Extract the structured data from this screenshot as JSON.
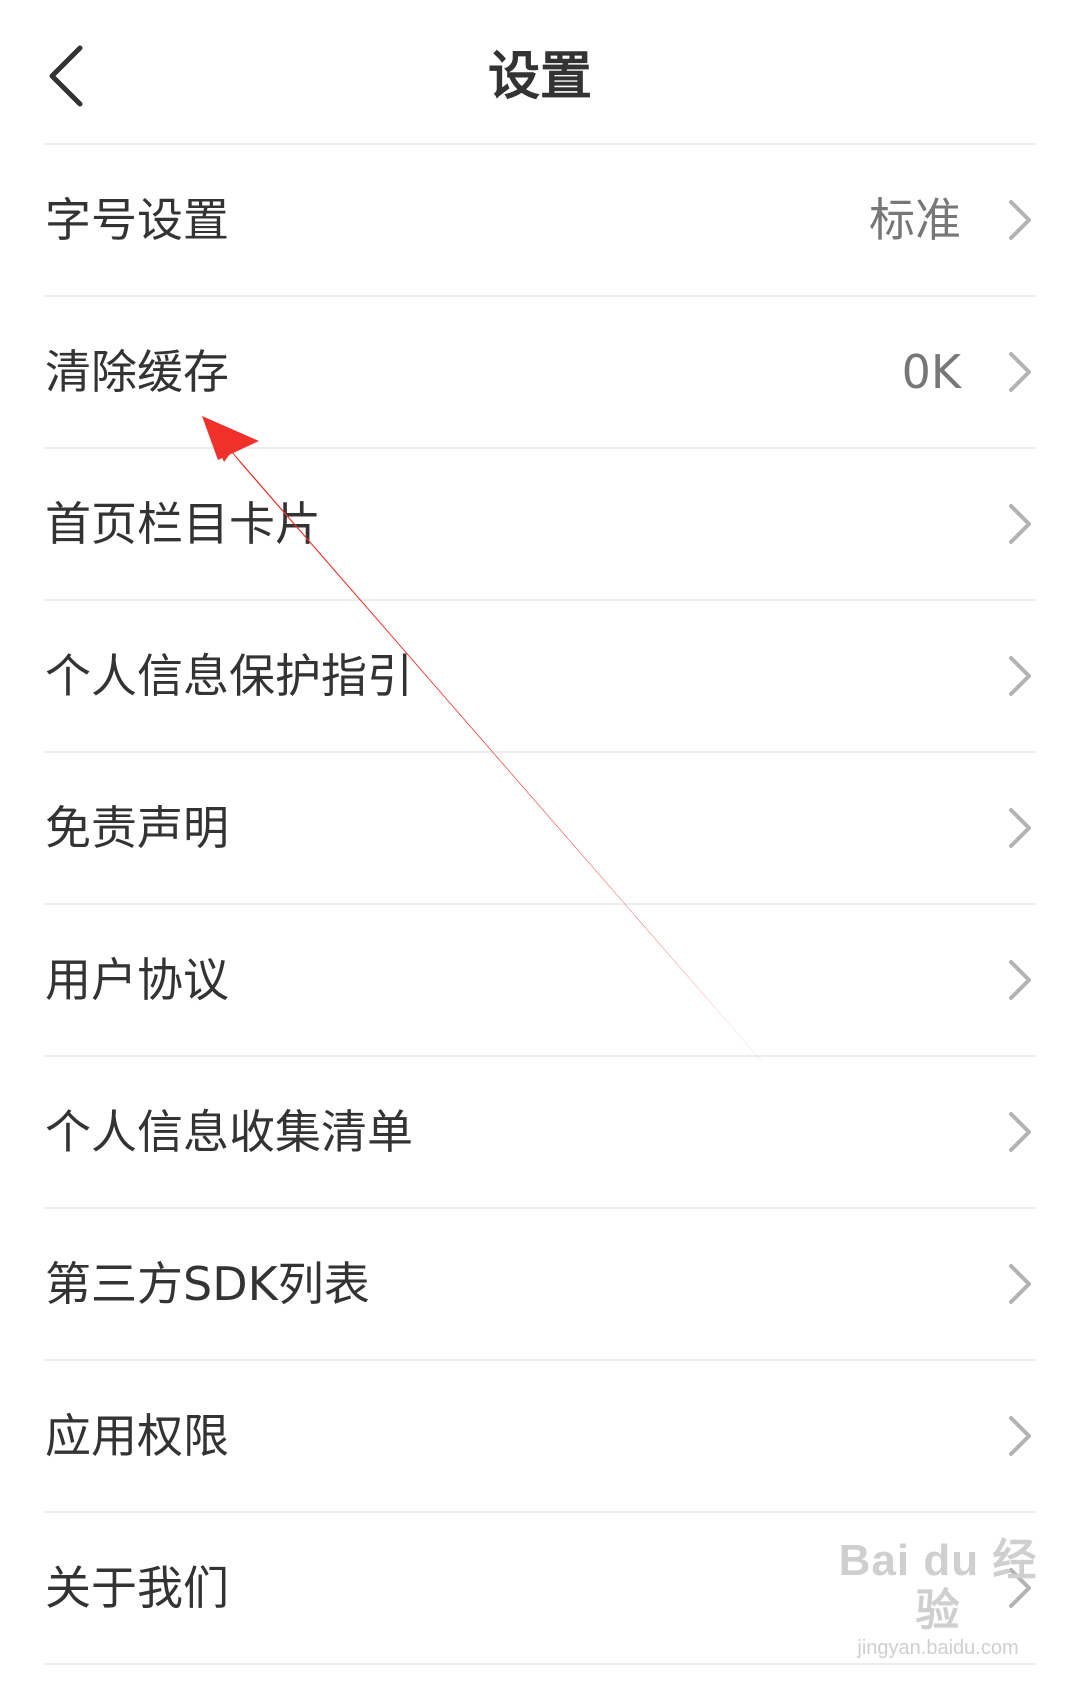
{
  "header": {
    "title": "设置",
    "back_icon": "chevron-left-icon"
  },
  "settings": {
    "items": [
      {
        "label": "字号设置",
        "value": "标准"
      },
      {
        "label": "清除缓存",
        "value": "0K"
      },
      {
        "label": "首页栏目卡片",
        "value": ""
      },
      {
        "label": "个人信息保护指引",
        "value": ""
      },
      {
        "label": "免责声明",
        "value": ""
      },
      {
        "label": "用户协议",
        "value": ""
      },
      {
        "label": "个人信息收集清单",
        "value": ""
      },
      {
        "label": "第三方SDK列表",
        "value": ""
      },
      {
        "label": "应用权限",
        "value": ""
      },
      {
        "label": "关于我们",
        "value": ""
      }
    ]
  },
  "colors": {
    "annotation_arrow": "#f0302a",
    "divider": "#ececec",
    "text": "#333333",
    "value_text": "#777777",
    "chevron": "#b3b3b3"
  },
  "watermark": {
    "logo": "Bai du 经验",
    "url": "jingyan.baidu.com"
  }
}
